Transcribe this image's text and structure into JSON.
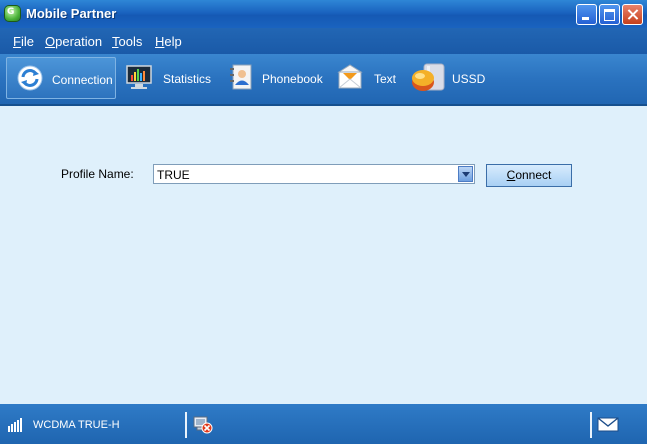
{
  "window": {
    "title": "Mobile Partner"
  },
  "menu": [
    {
      "key": "F",
      "rest": "ile"
    },
    {
      "key": "O",
      "rest": "peration"
    },
    {
      "key": "T",
      "rest": "ools"
    },
    {
      "key": "H",
      "rest": "elp"
    }
  ],
  "toolbar": {
    "connection": "Connection",
    "statistics": "Statistics",
    "phonebook": "Phonebook",
    "text": "Text",
    "ussd": "USSD"
  },
  "form": {
    "profile_label": "Profile Name:",
    "profile_value": "TRUE",
    "connect_key": "C",
    "connect_rest": "onnect"
  },
  "status": {
    "network": "WCDMA  TRUE-H"
  },
  "icons": {
    "app": "app-icon",
    "connection": "connection-refresh-icon",
    "statistics": "statistics-monitor-icon",
    "phonebook": "phonebook-icon",
    "text": "envelope-icon",
    "ussd": "ussd-disk-icon",
    "signal": "signal-strength-icon",
    "device_error": "device-error-icon",
    "mail": "mail-icon"
  }
}
